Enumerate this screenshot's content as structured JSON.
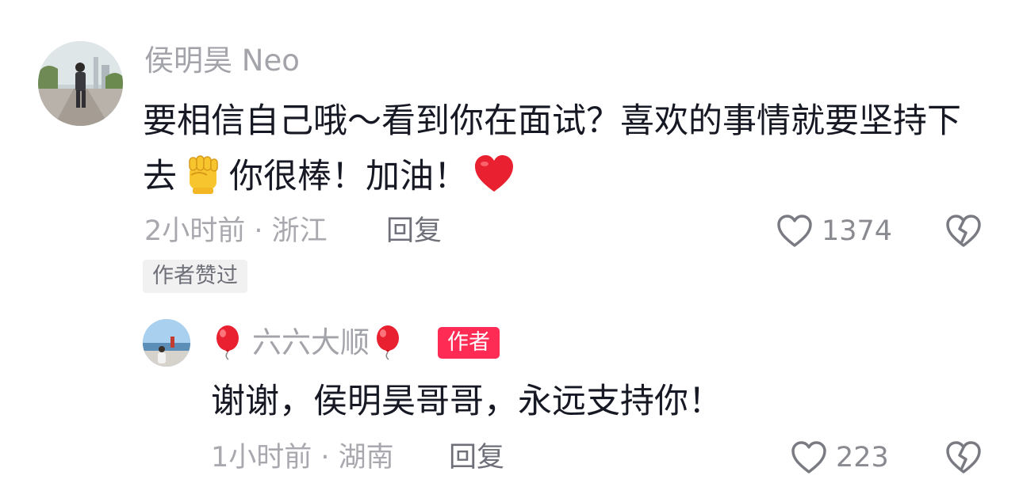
{
  "comments": [
    {
      "username": "侯明昊 Neo",
      "text_part1": "要相信自己哦～看到你在面试？喜欢的事情就要坚持下去",
      "text_part2": "你很棒！加油！",
      "emoji_1": "raised-fist-emoji",
      "emoji_2": "red-heart-emoji",
      "meta": "2小时前 · 浙江",
      "reply_label": "回复",
      "like_count": "1374",
      "badge": "作者赞过"
    },
    {
      "username": "六六大顺",
      "username_emoji": "balloon-emoji",
      "author_tag": "作者",
      "text": "谢谢，侯明昊哥哥，永远支持你！",
      "meta": "1小时前 · 湖南",
      "reply_label": "回复",
      "like_count": "223"
    }
  ],
  "colors": {
    "text_primary": "#161823",
    "text_secondary": "#a8a8ae",
    "author_tag_bg": "#fe2c55",
    "badge_bg": "#f1f1f2"
  }
}
